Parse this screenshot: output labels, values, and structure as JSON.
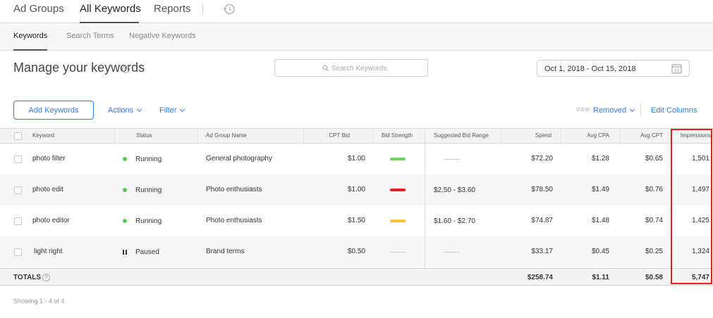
{
  "topnav": {
    "tabs": [
      "Ad Groups",
      "All Keywords",
      "Reports"
    ],
    "active": "All Keywords",
    "history_icon": "history-clock-icon"
  },
  "subnav": {
    "tabs": [
      "Keywords",
      "Search Terms",
      "Negative Keywords"
    ],
    "active": "Keywords"
  },
  "page": {
    "title": "Manage your keywords",
    "help_glyph": "?"
  },
  "search": {
    "placeholder": "Search Keywords",
    "icon": "search-icon"
  },
  "date_range": {
    "value": "Oct 1, 2018 - Oct 15, 2018",
    "icon": "calendar-icon",
    "calendar_day": "31"
  },
  "toolbar": {
    "add_label": "Add Keywords",
    "actions_label": "Actions",
    "filter_label": "Filter",
    "view_label": "VIEW:",
    "view_value": "Removed",
    "edit_columns_label": "Edit Columns"
  },
  "table": {
    "columns": [
      "Keyword",
      "Status",
      "Ad Group Name",
      "CPT Bid",
      "Bid Strength",
      "Suggested Bid Range",
      "Spend",
      "Avg CPA",
      "Avg CPT",
      "Impressions"
    ],
    "rows": [
      {
        "keyword": "photo filter",
        "status": "Running",
        "ad_group": "General photography",
        "cpt_bid": "$1.00",
        "bid_strength": "strong",
        "suggested_range": "",
        "spend": "$72.20",
        "avg_cpa": "$1.28",
        "avg_cpt": "$0.65",
        "impressions": "1,501"
      },
      {
        "keyword": "photo edit",
        "status": "Running",
        "ad_group": "Photo enthusiasts",
        "cpt_bid": "$1.00",
        "bid_strength": "weak",
        "suggested_range": "$2.50 - $3.60",
        "spend": "$78.50",
        "avg_cpa": "$1.49",
        "avg_cpt": "$0.76",
        "impressions": "1,497"
      },
      {
        "keyword": "photo editor",
        "status": "Running",
        "ad_group": "Photo enthusiasts",
        "cpt_bid": "$1.50",
        "bid_strength": "moderate",
        "suggested_range": "$1.60 - $2.70",
        "spend": "$74.87",
        "avg_cpa": "$1.48",
        "avg_cpt": "$0.74",
        "impressions": "1,425"
      },
      {
        "keyword": "light right",
        "status": "Paused",
        "ad_group": "Brand terms",
        "cpt_bid": "$0.50",
        "bid_strength": "none",
        "suggested_range": "",
        "spend": "$33.17",
        "avg_cpa": "$0.45",
        "avg_cpt": "$0.25",
        "impressions": "1,324"
      }
    ],
    "totals": {
      "label": "TOTALS",
      "spend": "$258.74",
      "avg_cpa": "$1.11",
      "avg_cpt": "$0.58",
      "impressions": "5,747"
    },
    "footer": "Showing 1 - 4 of 4"
  },
  "colors": {
    "accent": "#2f7ee0",
    "running": "#5cc85a",
    "strong": "#6fd468",
    "weak": "#e0221c",
    "moderate": "#f6c33a",
    "highlight": "#e2231a"
  }
}
